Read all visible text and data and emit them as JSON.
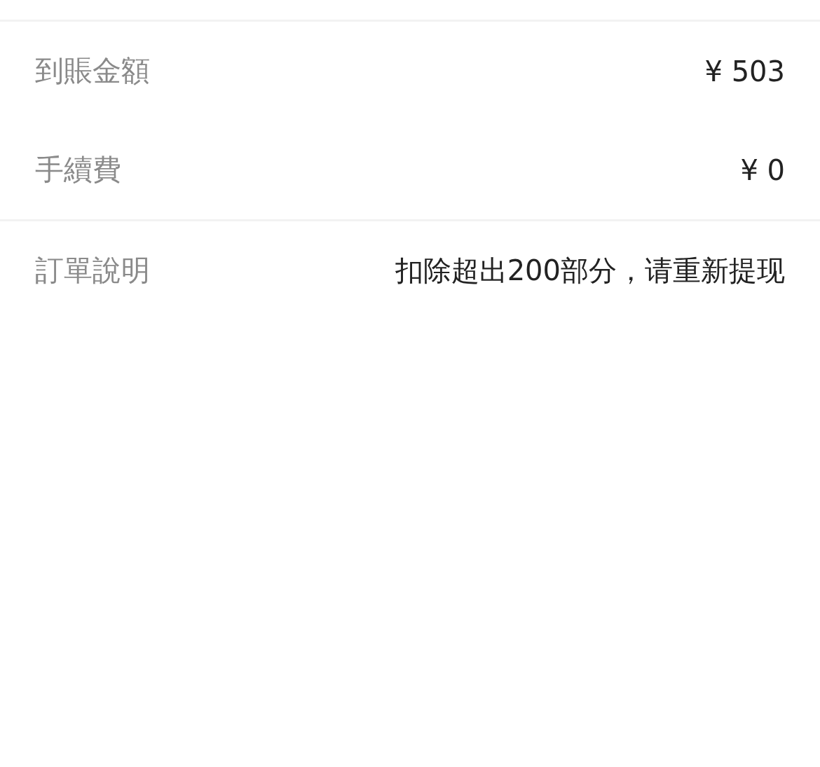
{
  "sections": [
    {
      "rows": [
        {
          "label": "到賬金額",
          "value": "¥ 503"
        },
        {
          "label": "手續費",
          "value": "¥ 0"
        }
      ]
    },
    {
      "rows": [
        {
          "label": "訂單說明",
          "value": "扣除超出200部分，请重新提现"
        }
      ]
    }
  ]
}
